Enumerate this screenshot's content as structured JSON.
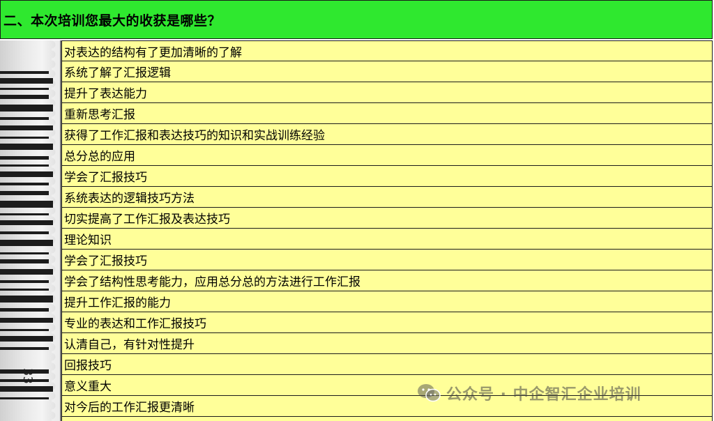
{
  "header": {
    "title": "二、本次培训您最大的收获是哪些？"
  },
  "barcode": {
    "number": "33"
  },
  "responses": [
    "对表达的结构有了更加清晰的了解",
    "系统了解了汇报逻辑",
    "提升了表达能力",
    "重新思考汇报",
    "获得了工作汇报和表达技巧的知识和实战训练经验",
    "总分总的应用",
    "学会了汇报技巧",
    "系统表达的逻辑技巧方法",
    "切实提高了工作汇报及表达技巧",
    "理论知识",
    "学会了汇报技巧",
    "学会了结构性思考能力，应用总分总的方法进行工作汇报",
    "提升工作汇报的能力",
    "专业的表达和工作汇报技巧",
    "认清自己，有针对性提升",
    "回报技巧",
    "意义重大",
    "对今后的工作汇报更清晰"
  ],
  "watermark": {
    "text": "公众号 · 中企智汇企业培训",
    "icon": "wechat-icon"
  },
  "colors": {
    "header_bg": "#2fe82f",
    "table_bg": "#ffff99",
    "border": "#1a1a1a"
  }
}
